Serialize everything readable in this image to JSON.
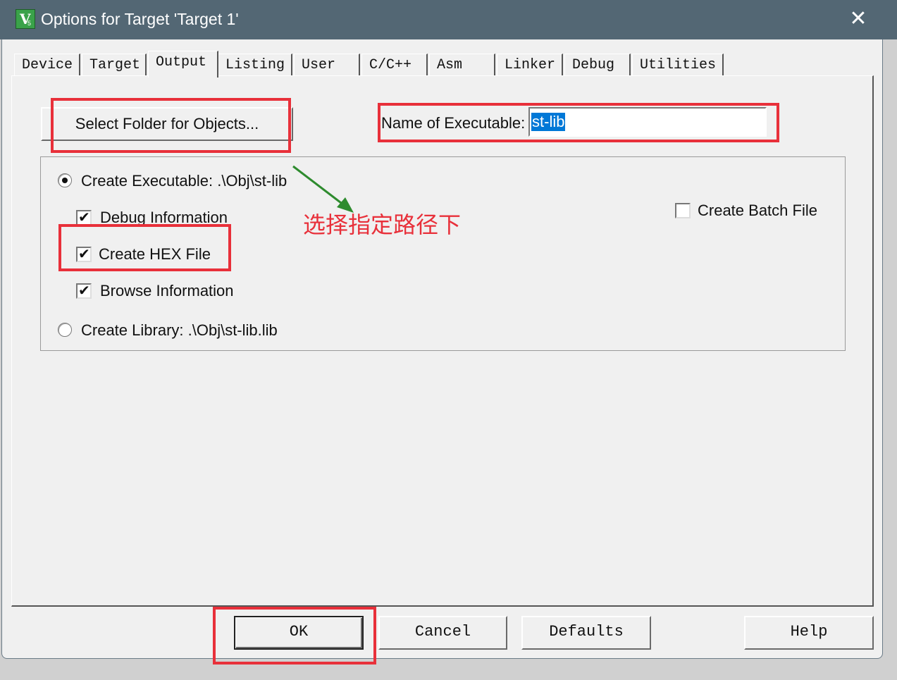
{
  "window": {
    "title": "Options for Target 'Target 1'",
    "close_glyph": "✕",
    "icon": {
      "main": "V",
      "sub": "5"
    }
  },
  "tabs": [
    {
      "label": "Device"
    },
    {
      "label": "Target"
    },
    {
      "label": "Output",
      "active": true
    },
    {
      "label": "Listing"
    },
    {
      "label": "User"
    },
    {
      "label": "C/C++"
    },
    {
      "label": "Asm"
    },
    {
      "label": "Linker"
    },
    {
      "label": "Debug"
    },
    {
      "label": "Utilities"
    }
  ],
  "output": {
    "select_folder_label": "Select Folder for Objects...",
    "exe_name_label": "Name of Executable:",
    "exe_name_value": "st-lib",
    "create_executable_label": "Create Executable:  .\\Obj\\st-lib",
    "create_executable_selected": true,
    "debug_info_label": "Debug Information",
    "debug_info_checked": true,
    "create_hex_label": "Create HEX File",
    "create_hex_checked": true,
    "browse_info_label": "Browse Information",
    "browse_info_checked": true,
    "create_library_label": "Create Library:  .\\Obj\\st-lib.lib",
    "create_library_selected": false,
    "create_batch_label": "Create Batch File",
    "create_batch_checked": false
  },
  "annotation": {
    "text": "选择指定路径下",
    "color": "#e8303a",
    "arrow_color": "#2e8b2e"
  },
  "buttons": {
    "ok": "OK",
    "cancel": "Cancel",
    "defaults": "Defaults",
    "help": "Help"
  },
  "colors": {
    "titlebar": "#536774",
    "highlight": "#0078d7",
    "red_box": "#e8303a"
  }
}
